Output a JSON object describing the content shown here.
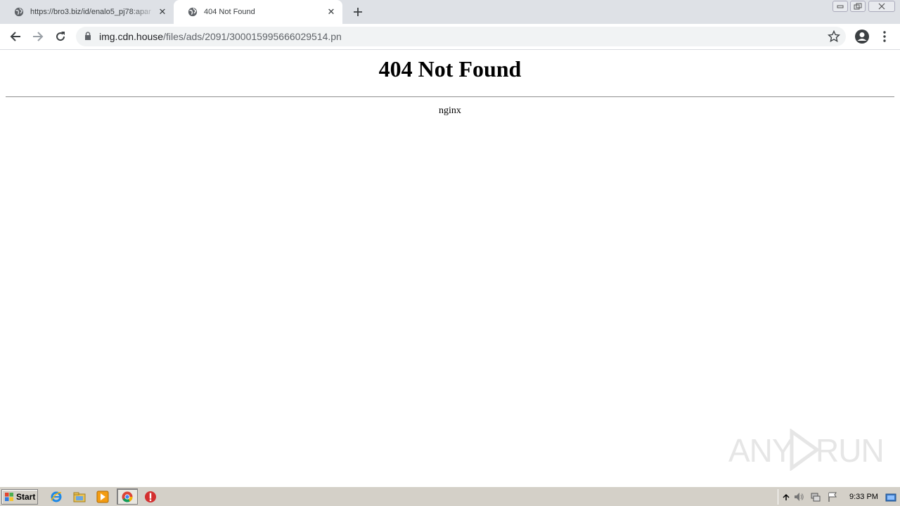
{
  "browser": {
    "tabs": [
      {
        "title": "https://bro3.biz/id/enalo5_pj78:apar",
        "active": false
      },
      {
        "title": "404 Not Found",
        "active": true
      }
    ],
    "address_bar": {
      "host": "img.cdn.house",
      "path": "/files/ads/2091/300015995666029514.pn"
    }
  },
  "page": {
    "heading": "404 Not Found",
    "server": "nginx"
  },
  "watermark": {
    "left": "ANY",
    "right": "RUN"
  },
  "taskbar": {
    "start_label": "Start",
    "clock": "9:33 PM"
  },
  "colors": {
    "tabstrip": "#dee1e6",
    "omnibox": "#f1f3f4",
    "taskbar": "#d4d0c8"
  }
}
